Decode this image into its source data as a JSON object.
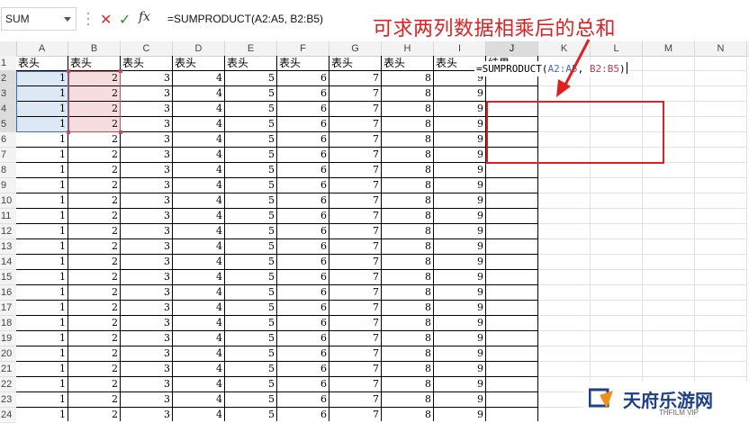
{
  "formula_bar": {
    "name_box": "SUM",
    "cancel_icon": "close-icon",
    "enter_icon": "check-icon",
    "fx_label": "fx",
    "formula": "=SUMPRODUCT(A2:A5, B2:B5)"
  },
  "columns": [
    "A",
    "B",
    "C",
    "D",
    "E",
    "F",
    "G",
    "H",
    "I",
    "J",
    "K",
    "L",
    "M",
    "N"
  ],
  "row_numbers": [
    "1",
    "2",
    "3",
    "4",
    "5",
    "6",
    "7",
    "8",
    "9",
    "10",
    "11",
    "12",
    "13",
    "14",
    "15",
    "16",
    "17",
    "18",
    "19",
    "20",
    "21",
    "22",
    "23",
    "24"
  ],
  "header_row": [
    "表头",
    "表头",
    "表头",
    "表头",
    "表头",
    "表头",
    "表头",
    "表头",
    "表头",
    "结果"
  ],
  "row_values": [
    1,
    2,
    3,
    4,
    5,
    6,
    7,
    8,
    9
  ],
  "data_row_count": 23,
  "editing_cell": {
    "prefix": "=SUMPRODUCT(",
    "range1": "A2:A5",
    "sep": ", ",
    "range2": "B2:B5",
    "suffix": ")"
  },
  "annotation": "可求两列数据相乘后的总和",
  "watermark": {
    "brand": "天府乐游网",
    "sub": "THFILM VIP"
  },
  "colors": {
    "annotation": "#e02020",
    "range_a": "#3b6fbf",
    "range_b": "#d04a5a"
  }
}
